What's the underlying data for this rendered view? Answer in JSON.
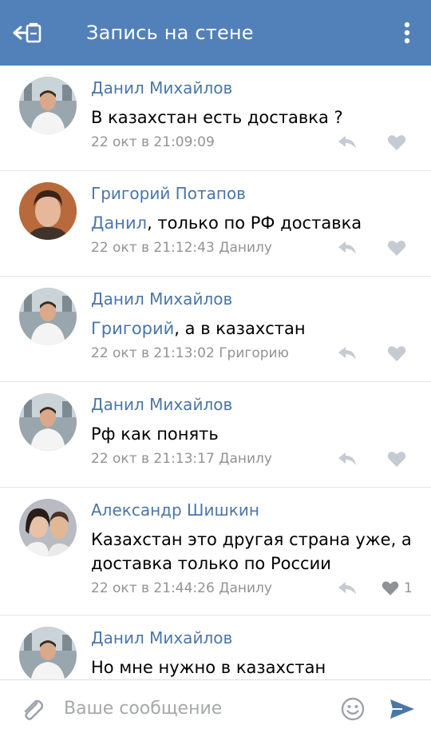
{
  "header": {
    "title": "Запись на стене",
    "back_icon": "back-arrow-icon",
    "menu_icon": "more-vertical-icon"
  },
  "colors": {
    "header_bg": "#5181b8",
    "link": "#4a76a8",
    "meta": "#939393"
  },
  "comments": [
    {
      "author": "Данил Михайлов",
      "mention": "",
      "text": "В казахстан есть доставка ?",
      "meta": "22 окт в 21:09:09",
      "likes": ""
    },
    {
      "author": "Григорий Потапов",
      "mention": "Данил",
      "text": ", только по РФ доставка",
      "meta": "22 окт в 21:12:43 Данилу",
      "likes": ""
    },
    {
      "author": "Данил Михайлов",
      "mention": "Григорий",
      "text": ", а в казахстан",
      "meta": "22 окт в 21:13:02 Григорию",
      "likes": ""
    },
    {
      "author": "Данил Михайлов",
      "mention": "",
      "text": "Рф как понять",
      "meta": "22 окт в 21:13:17 Данилу",
      "likes": ""
    },
    {
      "author": "Александр Шишкин",
      "mention": "",
      "text": "Казахстан это другая страна уже, а доставка только по России",
      "meta": "22 окт в 21:44:26 Данилу",
      "likes": "1"
    },
    {
      "author": "Данил Михайлов",
      "mention": "",
      "text": "Но мне нужно в казахстан",
      "meta": "",
      "likes": ""
    }
  ],
  "composer": {
    "placeholder": "Ваше сообщение",
    "attach_icon": "paperclip-icon",
    "emoji_icon": "smile-icon",
    "send_icon": "send-icon"
  }
}
